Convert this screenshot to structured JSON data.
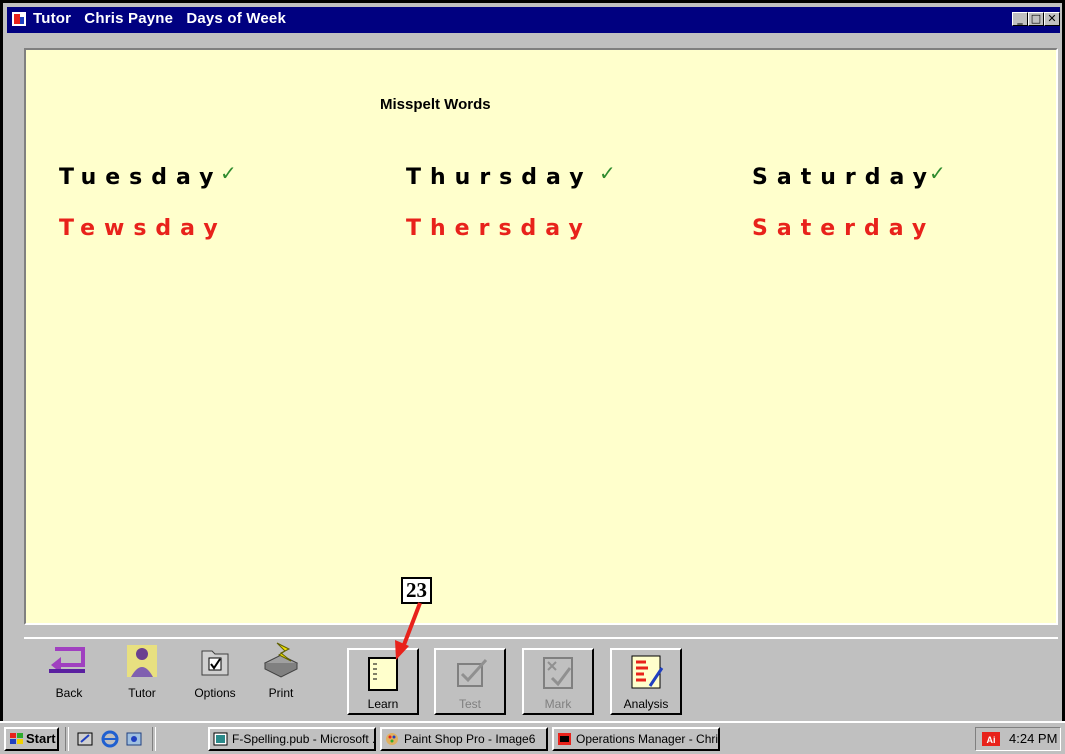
{
  "window": {
    "title": "Tutor   Chris Payne   Days of Week",
    "minimize_glyph": "_",
    "maximize_glyph": "□",
    "close_glyph": "✕"
  },
  "content": {
    "heading": "Misspelt Words",
    "check_glyph": "✓",
    "words": [
      {
        "correct": "Tuesday",
        "misspelt": "Tewsday"
      },
      {
        "correct": "Thursday",
        "misspelt": "Thersday"
      },
      {
        "correct": "Saturday",
        "misspelt": "Saterday"
      }
    ],
    "callout_number": "23"
  },
  "toolbar": {
    "back_label": "Back",
    "tutor_label": "Tutor",
    "options_label": "Options",
    "print_label": "Print",
    "learn_label": "Learn",
    "test_label": "Test",
    "mark_label": "Mark",
    "analysis_label": "Analysis"
  },
  "taskbar": {
    "start_label": "Start",
    "tasks": [
      "F-Spelling.pub - Microsoft ...",
      "Paint Shop Pro - Image6",
      "Operations Manager - Chri..."
    ],
    "clock": "4:24 PM"
  },
  "colors": {
    "titlebar": "#000080",
    "content_bg": "#ffffcc",
    "misspelt_red": "#e8221b",
    "check_green": "#2e8b2e",
    "arrow_red": "#e8221b"
  },
  "icons": [
    "back-arrow-icon",
    "tutor-person-icon",
    "options-checkbox-icon",
    "print-icon",
    "learn-notebook-icon",
    "test-check-icon",
    "mark-icon",
    "analysis-icon",
    "windows-flag-icon"
  ]
}
